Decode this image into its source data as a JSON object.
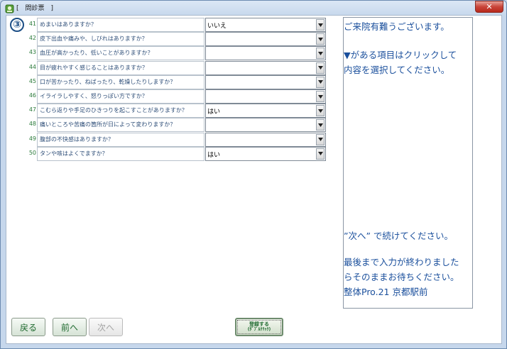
{
  "window": {
    "title": "[　問診票　]",
    "close_label": "✕"
  },
  "step_marker": "③",
  "questions": [
    {
      "num": "41",
      "text": "めまいはありますか？",
      "answer": "いいえ"
    },
    {
      "num": "42",
      "text": "皮下出血や痛みや、しびれはありますか？",
      "answer": ""
    },
    {
      "num": "43",
      "text": "血圧が高かったり、低いことがありますか？",
      "answer": ""
    },
    {
      "num": "44",
      "text": "目が疲れやすく感じることはありますか？",
      "answer": ""
    },
    {
      "num": "45",
      "text": "口が苦かったり、ねばったり、乾燥したりしますか？",
      "answer": ""
    },
    {
      "num": "46",
      "text": "イライラしやすく、怒りっぽい方ですか？",
      "answer": ""
    },
    {
      "num": "47",
      "text": "こむら返りや手足のひきつりを起こすことがありますか？",
      "answer": "はい"
    },
    {
      "num": "48",
      "text": "痛いところや苦痛の箇所が日によって変わりますか？",
      "answer": ""
    },
    {
      "num": "49",
      "text": "腹部の不快感はありますか？",
      "answer": ""
    },
    {
      "num": "50",
      "text": "タンや咳はよくでますか？",
      "answer": "はい"
    }
  ],
  "info": {
    "greeting": "ご来院有難うございます。",
    "instruction_1": "▼がある項目はクリックして",
    "instruction_2": "内容を選択してください。",
    "next_hint": "”次へ” で続けてください。",
    "finish_1": "最後まで入力が終わりました",
    "finish_2": "らそのままお待ちください。",
    "clinic": "整体Pro.21 京都駅前"
  },
  "buttons": {
    "back": "戻る",
    "prev": "前へ",
    "next": "次へ",
    "register_line1": "登録する",
    "register_line2": "(ﾀﾞﾌﾞﾙｸﾘｯｸ)"
  },
  "colors": {
    "accent_green": "#1f6a2f",
    "info_blue": "#1a4f9c",
    "title_bar": "#c6d7ec",
    "close_red": "#c9453a"
  },
  "icons": {
    "app": "app-leaf-icon",
    "dropdown": "chevron-down-icon"
  }
}
